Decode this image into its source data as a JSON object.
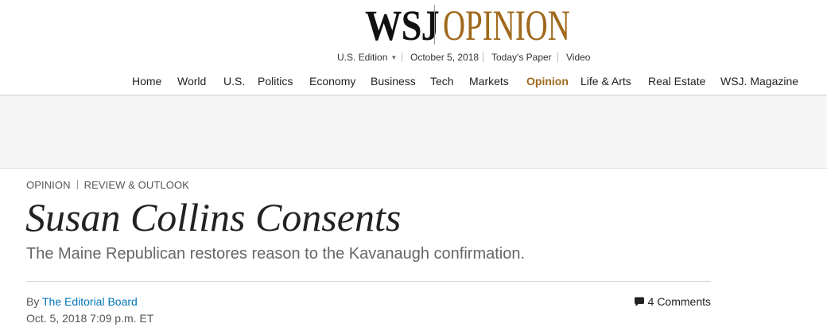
{
  "masthead": {
    "logo_wsj": "WSJ",
    "logo_section": "OPINION",
    "section_color": "#a0691b"
  },
  "subnav": {
    "edition": "U.S. Edition",
    "date": "October 5, 2018",
    "todays_paper": "Today's Paper",
    "video": "Video"
  },
  "nav": {
    "items": [
      {
        "label": "Home"
      },
      {
        "label": "World"
      },
      {
        "label": "U.S."
      },
      {
        "label": "Politics"
      },
      {
        "label": "Economy"
      },
      {
        "label": "Business"
      },
      {
        "label": "Tech"
      },
      {
        "label": "Markets"
      },
      {
        "label": "Opinion",
        "active": true
      },
      {
        "label": "Life & Arts"
      },
      {
        "label": "Real Estate"
      },
      {
        "label": "WSJ. Magazine"
      }
    ]
  },
  "article": {
    "section": "Opinion",
    "column": "Review & Outlook",
    "headline": "Susan Collins Consents",
    "dek": "The Maine Republican restores reason to the Kavanaugh confirmation.",
    "byline_prefix": "By",
    "author": "The Editorial Board",
    "timestamp": "Oct. 5, 2018 7:09 p.m. ET",
    "comments": "4 Comments",
    "link_color": "#0274b6"
  }
}
